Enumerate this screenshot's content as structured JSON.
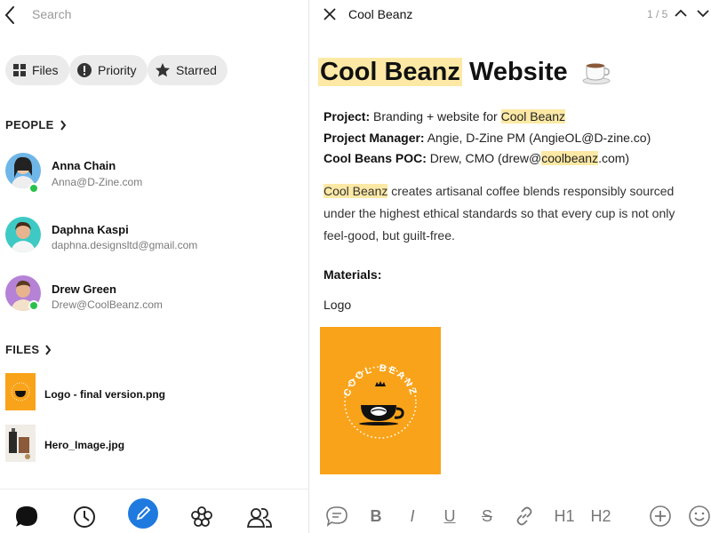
{
  "left": {
    "search": {
      "placeholder": "Search"
    },
    "chips": [
      {
        "label": "Files",
        "icon": "grid-icon"
      },
      {
        "label": "Priority",
        "icon": "alert-icon"
      },
      {
        "label": "Starred",
        "icon": "star-icon"
      }
    ],
    "people_title": "PEOPLE",
    "people": [
      {
        "name": "Anna Chain",
        "email": "Anna@D-Zine.com",
        "online": true
      },
      {
        "name": "Daphna Kaspi",
        "email": "daphna.designsltd@gmail.com",
        "online": false
      },
      {
        "name": "Drew Green",
        "email": "Drew@CoolBeanz.com",
        "online": true
      }
    ],
    "files_title": "FILES",
    "files": [
      {
        "name": "Logo - final version.png"
      },
      {
        "name": "Hero_Image.jpg"
      }
    ],
    "nav": [
      "chat-icon",
      "clock-icon",
      "pencil-icon",
      "flower-icon",
      "contacts-icon"
    ]
  },
  "right": {
    "top_title": "Cool Beanz",
    "counter": "1 / 5",
    "heading_hl": "Cool Beanz",
    "heading_rest": "Website",
    "project_label": "Project:",
    "project_text": "Branding + website for",
    "project_hl": "Cool Beanz",
    "pm_label": "Project Manager:",
    "pm_text": "Angie, D-Zine PM (AngieOL@D-zine.co)",
    "poc_label": "Cool Beans POC:",
    "poc_text_a": "Drew, CMO (drew@",
    "poc_hl": "coolbeanz",
    "poc_text_b": ".com)",
    "para_hl": "Cool Beanz",
    "para_text": "creates artisanal coffee blends responsibly sourced under the highest ethical standards so that every cup is not only feel-good, but guilt-free.",
    "materials_label": "Materials:",
    "logo_label": "Logo",
    "logo_text": "COOL BEANZ",
    "toolbar": {
      "h1": "H1",
      "h2": "H2",
      "bold": "B",
      "italic": "I",
      "underline": "U",
      "strike": "S"
    }
  },
  "colors": {
    "accent_blue": "#1f7ae0",
    "highlight": "#fde9a5",
    "logo_orange": "#f9a31a",
    "online_green": "#2bc04a"
  }
}
